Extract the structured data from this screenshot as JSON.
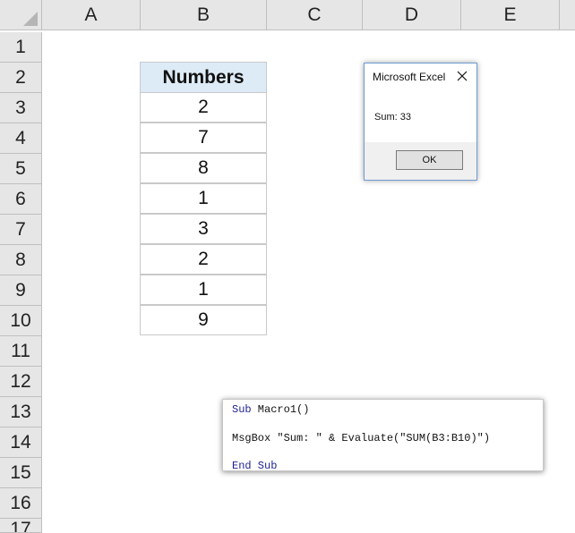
{
  "columns": [
    "A",
    "B",
    "C",
    "D",
    "E"
  ],
  "rows": [
    "1",
    "2",
    "3",
    "4",
    "5",
    "6",
    "7",
    "8",
    "9",
    "10",
    "11",
    "12",
    "13",
    "14",
    "15",
    "16",
    "17"
  ],
  "table": {
    "header": "Numbers",
    "values": [
      "2",
      "7",
      "8",
      "1",
      "3",
      "2",
      "1",
      "9"
    ]
  },
  "msgbox": {
    "title": "Microsoft Excel",
    "message": "Sum: 33",
    "ok_label": "OK"
  },
  "code": {
    "line1_kw": "Sub",
    "line1_rest": " Macro1()",
    "line2": "MsgBox \"Sum: \" & Evaluate(\"SUM(B3:B10)\")",
    "line3": "End Sub"
  },
  "colors": {
    "header_fill": "#ddebf7",
    "grid_header": "#e6e6e6",
    "keyword": "#1f1f8f"
  }
}
